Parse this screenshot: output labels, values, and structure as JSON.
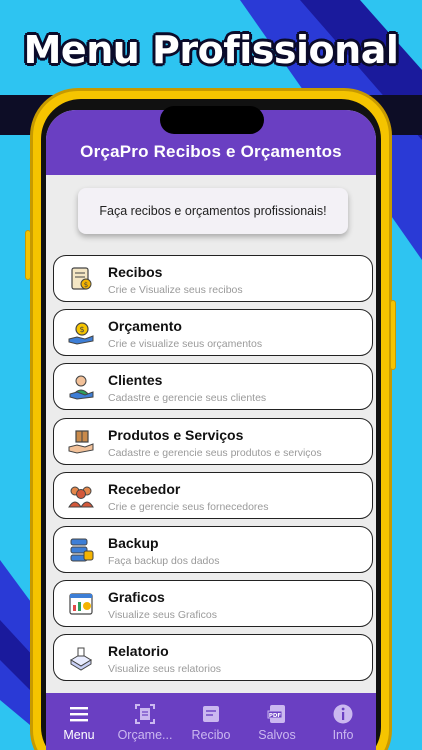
{
  "promo": {
    "headline": "Menu Profissional"
  },
  "app": {
    "title": "OrçaPro Recibos e Orçamentos",
    "tagline": "Faça recibos e orçamentos profissionais!"
  },
  "menu": [
    {
      "label": "Recibos",
      "sub": "Crie e Visualize seus recibos",
      "icon": "receipt-icon"
    },
    {
      "label": "Orçamento",
      "sub": "Crie e visualize seus orçamentos",
      "icon": "money-hand-icon"
    },
    {
      "label": "Clientes",
      "sub": "Cadastre e gerencie seus clientes",
      "icon": "client-icon"
    },
    {
      "label": "Produtos e Serviços",
      "sub": "Cadastre e gerencie seus produtos e serviços",
      "icon": "box-hand-icon"
    },
    {
      "label": "Recebedor",
      "sub": "Crie e gerencie seus fornecedores",
      "icon": "people-group-icon"
    },
    {
      "label": "Backup",
      "sub": "Faça backup dos dados",
      "icon": "database-icon"
    },
    {
      "label": "Graficos",
      "sub": "Visualize seus Graficos",
      "icon": "chart-icon"
    },
    {
      "label": "Relatorio",
      "sub": "Visualize seus relatorios",
      "icon": "report-icon"
    }
  ],
  "nav": [
    {
      "label": "Menu",
      "icon": "hamburger-icon",
      "active": true
    },
    {
      "label": "Orçame...",
      "icon": "scan-document-icon",
      "active": false
    },
    {
      "label": "Recibo",
      "icon": "receipt-edit-icon",
      "active": false
    },
    {
      "label": "Salvos",
      "icon": "pdf-icon",
      "active": false
    },
    {
      "label": "Info",
      "icon": "info-icon",
      "active": false
    }
  ],
  "colors": {
    "primary": "#6a3fc2",
    "background": "#2ec4f1",
    "frame": "#f5c400",
    "accent": "#2a3ad6"
  }
}
